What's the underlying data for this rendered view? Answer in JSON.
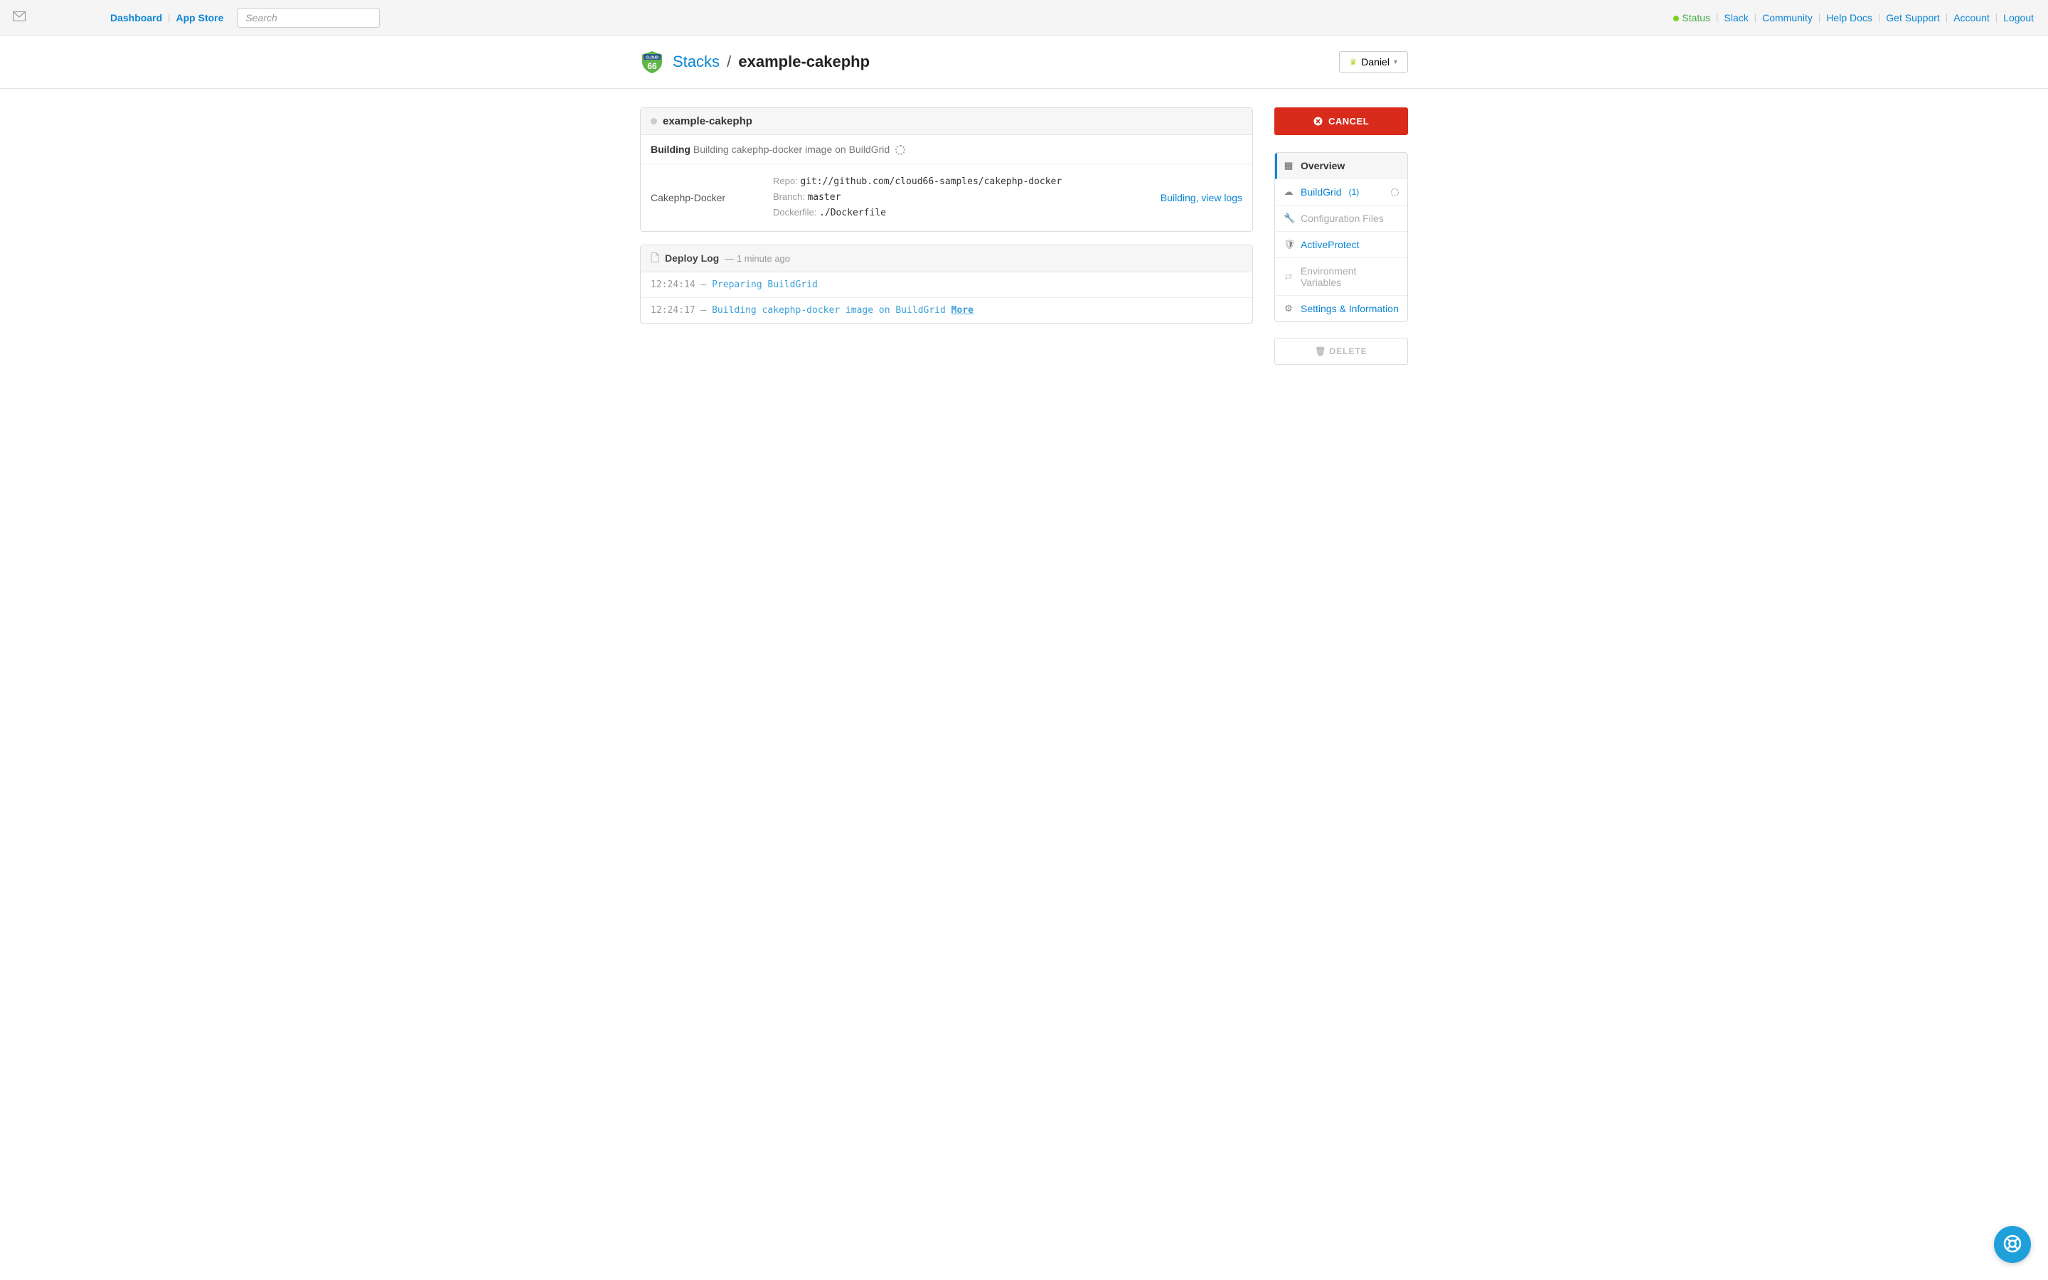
{
  "topnav": {
    "dashboard": "Dashboard",
    "appstore": "App Store",
    "search_placeholder": "Search",
    "status": "Status",
    "slack": "Slack",
    "community": "Community",
    "helpdocs": "Help Docs",
    "getsupport": "Get Support",
    "account": "Account",
    "logout": "Logout"
  },
  "breadcrumb": {
    "stacks": "Stacks",
    "separator": "/",
    "current": "example-cakephp"
  },
  "user": {
    "name": "Daniel"
  },
  "stack": {
    "name": "example-cakephp",
    "status_label": "Building",
    "status_msg": "Building cakephp-docker image on BuildGrid"
  },
  "service": {
    "name": "Cakephp-Docker",
    "repo_label": "Repo:",
    "repo": "git://github.com/cloud66-samples/cakephp-docker",
    "branch_label": "Branch:",
    "branch": "master",
    "dockerfile_label": "Dockerfile:",
    "dockerfile": "./Dockerfile",
    "link": "Building, view logs"
  },
  "deploylog": {
    "title": "Deploy Log",
    "time": "— 1 minute ago",
    "rows": [
      {
        "ts": "12:24:14",
        "dash": "—",
        "msg": "Preparing BuildGrid"
      },
      {
        "ts": "12:24:17",
        "dash": "—",
        "msg": "Building cakephp-docker image on BuildGrid",
        "more": "More"
      }
    ]
  },
  "actions": {
    "cancel": "CANCEL",
    "delete": "DELETE"
  },
  "sidemenu": {
    "overview": "Overview",
    "buildgrid": "BuildGrid",
    "buildgrid_count": "(1)",
    "config": "Configuration Files",
    "activeprotect": "ActiveProtect",
    "envvars": "Environment Variables",
    "settings": "Settings & Information"
  }
}
